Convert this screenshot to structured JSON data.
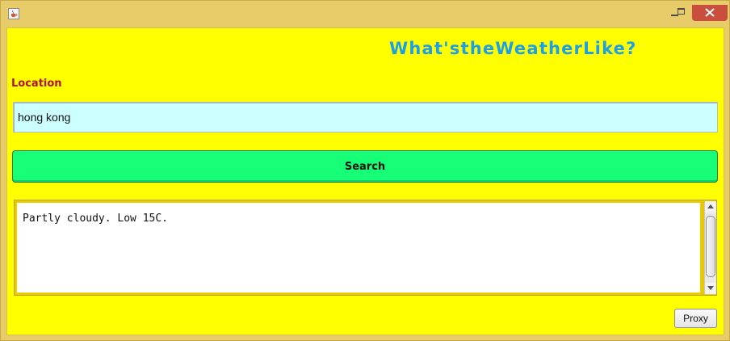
{
  "window": {
    "icon": "java-cup-icon",
    "controls": {
      "minimize": "minimize-icon",
      "maximize": "maximize-icon",
      "close": "close-icon"
    }
  },
  "header": {
    "title": "What'stheWeatherLike?"
  },
  "form": {
    "location_label": "Location",
    "location_value": "hong kong",
    "search_label": "Search"
  },
  "result": {
    "text": "Partly cloudy. Low 15C."
  },
  "footer": {
    "proxy_label": "Proxy"
  },
  "colors": {
    "window_frame": "#e9cc6a",
    "background": "#ffff00",
    "title": "#1ea0e6",
    "label": "#b01010",
    "input_bg": "#ccffff",
    "search_button": "#16ff76",
    "close_button": "#c94e3e"
  }
}
